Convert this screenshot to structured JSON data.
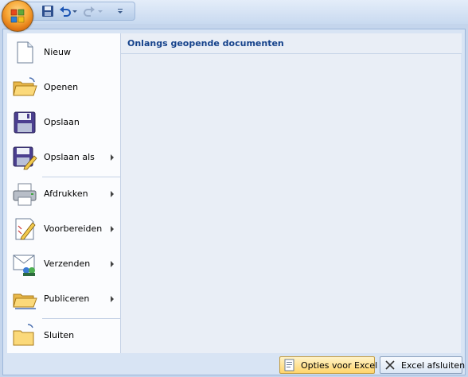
{
  "quick_access": {
    "items": [
      "save-icon",
      "undo-icon",
      "redo-icon",
      "customize-icon"
    ]
  },
  "menu": {
    "items": [
      {
        "label": "Nieuw",
        "has_submenu": false
      },
      {
        "label": "Openen",
        "has_submenu": false
      },
      {
        "label": "Opslaan",
        "has_submenu": false
      },
      {
        "label": "Opslaan als",
        "has_submenu": true
      },
      {
        "label": "Afdrukken",
        "has_submenu": true
      },
      {
        "label": "Voorbereiden",
        "has_submenu": true
      },
      {
        "label": "Verzenden",
        "has_submenu": true
      },
      {
        "label": "Publiceren",
        "has_submenu": true
      },
      {
        "label": "Sluiten",
        "has_submenu": false
      }
    ]
  },
  "recent": {
    "title": "Onlangs geopende documenten"
  },
  "footer": {
    "options_label": "Opties voor Excel",
    "exit_label": "Excel afsluiten"
  },
  "colors": {
    "accent": "#15428b",
    "office_orange": "#f7a533",
    "frame_blue": "#c4d5ec"
  }
}
